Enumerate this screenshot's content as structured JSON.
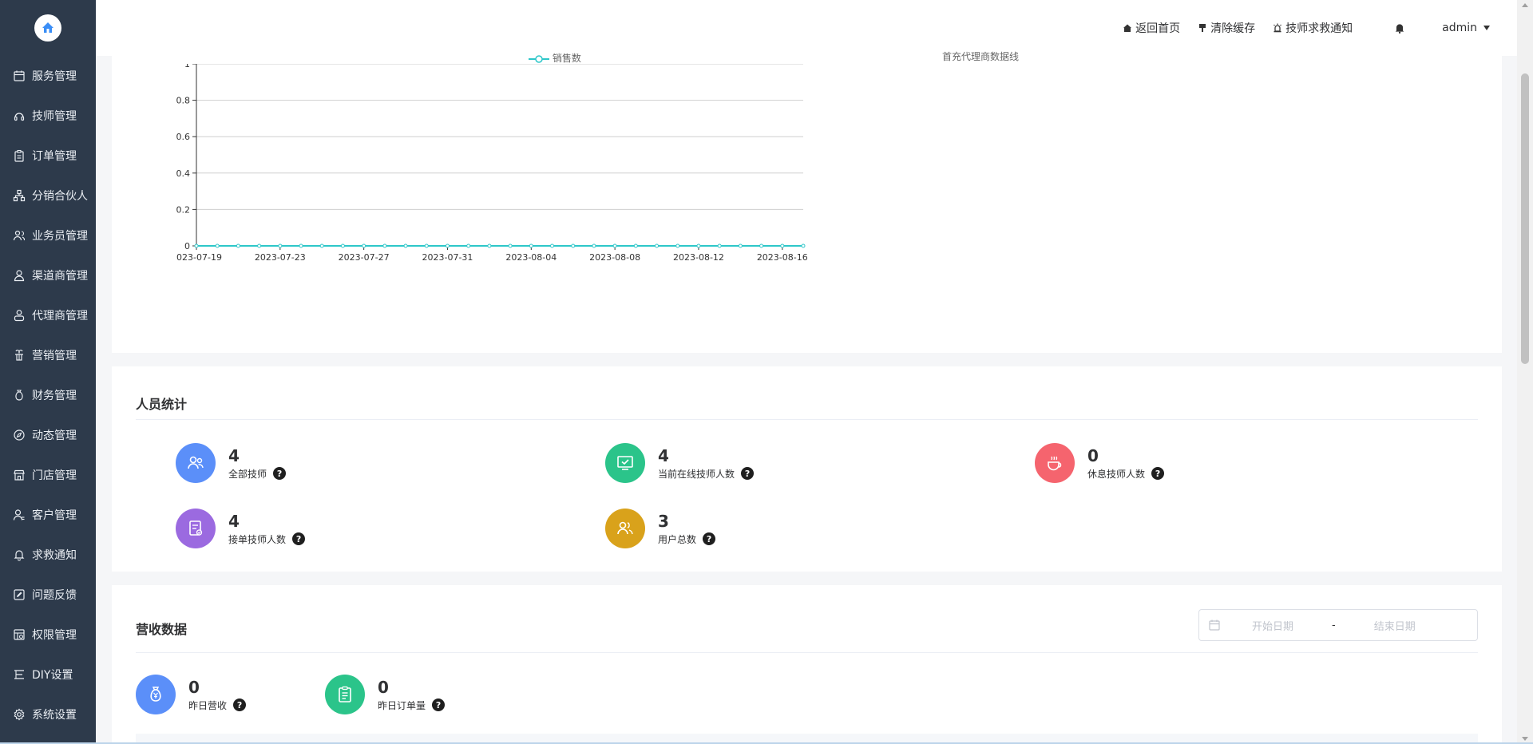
{
  "header": {
    "home": "返回首页",
    "clear_cache": "清除缓存",
    "rescue_notice": "技师求救通知",
    "user": "admin"
  },
  "sidebar": {
    "items": [
      {
        "label": "服务管理",
        "icon": "calendar-icon"
      },
      {
        "label": "技师管理",
        "icon": "headset-icon"
      },
      {
        "label": "订单管理",
        "icon": "clipboard-icon"
      },
      {
        "label": "分销合伙人",
        "icon": "network-icon"
      },
      {
        "label": "业务员管理",
        "icon": "users-icon"
      },
      {
        "label": "渠道商管理",
        "icon": "user-icon"
      },
      {
        "label": "代理商管理",
        "icon": "user-group-icon"
      },
      {
        "label": "营销管理",
        "icon": "gift-icon"
      },
      {
        "label": "财务管理",
        "icon": "moneybag-icon"
      },
      {
        "label": "动态管理",
        "icon": "compass-icon"
      },
      {
        "label": "门店管理",
        "icon": "store-icon"
      },
      {
        "label": "客户管理",
        "icon": "customer-icon"
      },
      {
        "label": "求救通知",
        "icon": "bell-icon"
      },
      {
        "label": "问题反馈",
        "icon": "edit-icon"
      },
      {
        "label": "权限管理",
        "icon": "permission-icon"
      },
      {
        "label": "DIY设置",
        "icon": "diy-icon"
      },
      {
        "label": "系统设置",
        "icon": "settings-icon"
      }
    ]
  },
  "chart_data": {
    "type": "line",
    "legend_partial": [
      "销售数",
      "首充代理商数据线"
    ],
    "x": [
      "2023-07-19",
      "2023-07-20",
      "2023-07-21",
      "2023-07-22",
      "2023-07-23",
      "2023-07-24",
      "2023-07-25",
      "2023-07-26",
      "2023-07-27",
      "2023-07-28",
      "2023-07-29",
      "2023-07-30",
      "2023-07-31",
      "2023-08-01",
      "2023-08-02",
      "2023-08-03",
      "2023-08-04",
      "2023-08-05",
      "2023-08-06",
      "2023-08-07",
      "2023-08-08",
      "2023-08-09",
      "2023-08-10",
      "2023-08-11",
      "2023-08-12",
      "2023-08-13",
      "2023-08-14",
      "2023-08-15",
      "2023-08-16",
      "2023-08-17"
    ],
    "x_ticks": [
      "2023-07-19",
      "2023-07-23",
      "2023-07-27",
      "2023-07-31",
      "2023-08-04",
      "2023-08-08",
      "2023-08-12",
      "2023-08-16"
    ],
    "y_ticks": [
      "0",
      "0.2",
      "0.4",
      "0.6",
      "0.8",
      "1"
    ],
    "ylim": [
      0,
      1
    ],
    "series": [
      {
        "values": [
          0,
          0,
          0,
          0,
          0,
          0,
          0,
          0,
          0,
          0,
          0,
          0,
          0,
          0,
          0,
          0,
          0,
          0,
          0,
          0,
          0,
          0,
          0,
          0,
          0,
          0,
          0,
          0,
          0,
          0
        ],
        "color": "#2ec7c9"
      }
    ],
    "grid": true
  },
  "people": {
    "title": "人员统计",
    "stats": [
      {
        "value": "4",
        "label": "全部技师",
        "color": "#5b8ff9"
      },
      {
        "value": "4",
        "label": "当前在线技师人数",
        "color": "#2bc48a"
      },
      {
        "value": "0",
        "label": "休息技师人数",
        "color": "#f5646e"
      },
      {
        "value": "4",
        "label": "接单技师人数",
        "color": "#9b6ae0"
      },
      {
        "value": "3",
        "label": "用户总数",
        "color": "#d9a21b"
      }
    ]
  },
  "revenue": {
    "title": "营收数据",
    "start_placeholder": "开始日期",
    "end_placeholder": "结束日期",
    "separator": "-",
    "stats": [
      {
        "value": "0",
        "label": "昨日营收",
        "color": "#5b8ff9"
      },
      {
        "value": "0",
        "label": "昨日订单量",
        "color": "#2bc48a"
      }
    ]
  }
}
